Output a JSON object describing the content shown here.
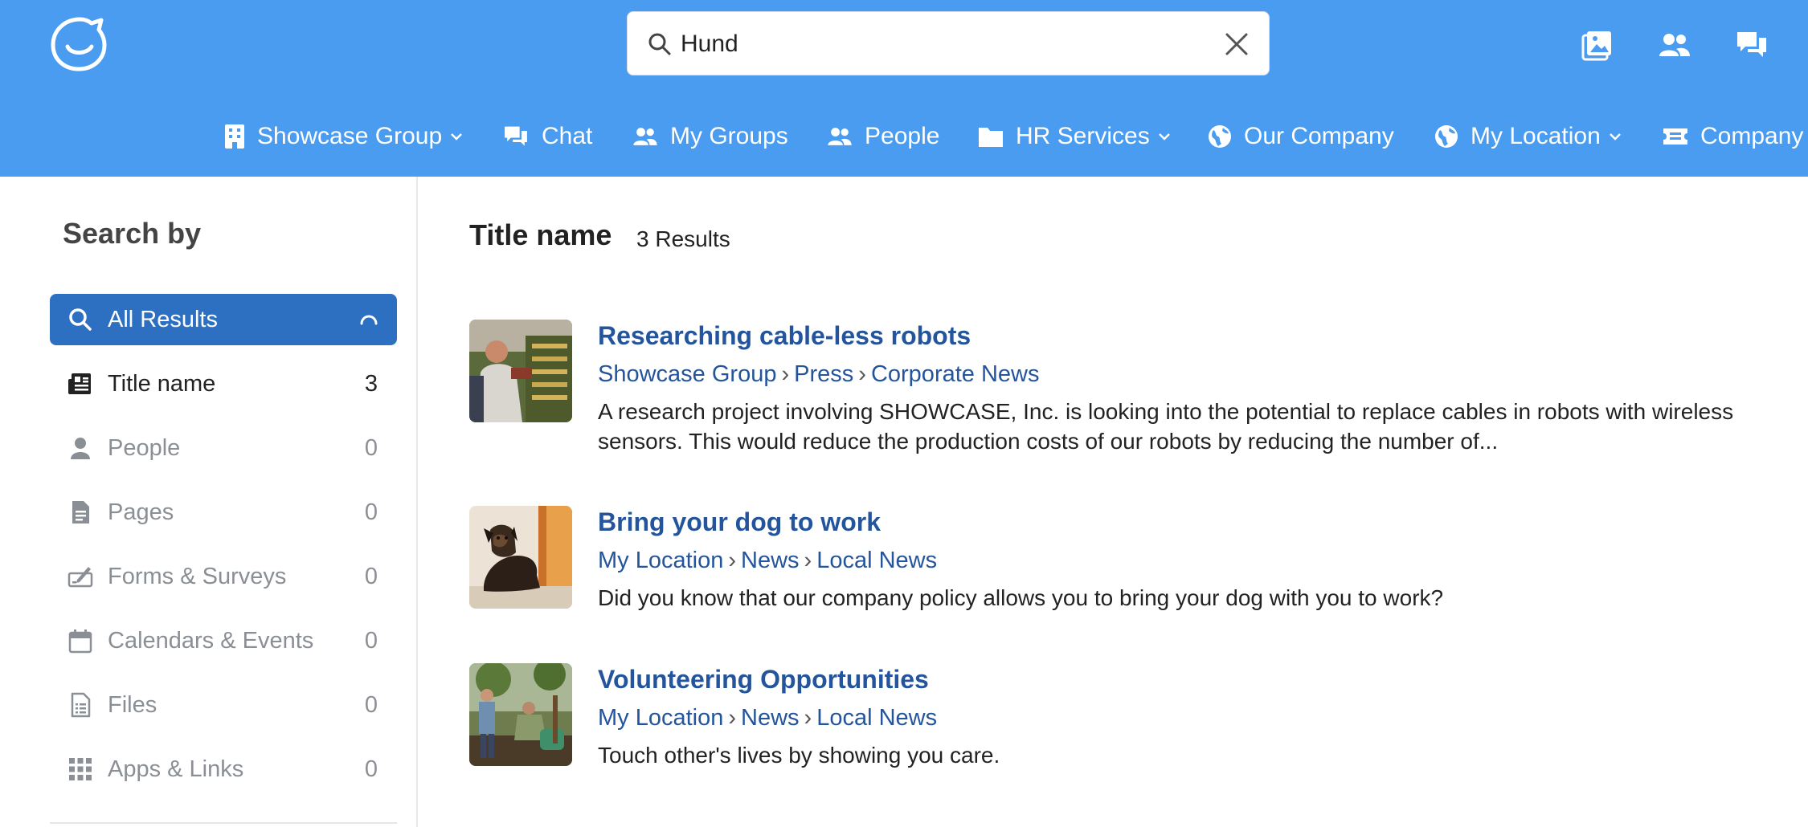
{
  "header": {
    "search": {
      "value": "Hund",
      "placeholder": ""
    },
    "nav": [
      {
        "label": "Showcase Group",
        "icon": "building-icon",
        "dropdown": true
      },
      {
        "label": "Chat",
        "icon": "chat-icon",
        "dropdown": false
      },
      {
        "label": "My Groups",
        "icon": "users-icon",
        "dropdown": false
      },
      {
        "label": "People",
        "icon": "users-icon",
        "dropdown": false
      },
      {
        "label": "HR Services",
        "icon": "folder-icon",
        "dropdown": true
      },
      {
        "label": "Our Company",
        "icon": "globe-icon",
        "dropdown": false
      },
      {
        "label": "My Location",
        "icon": "globe-icon",
        "dropdown": true
      },
      {
        "label": "Company",
        "icon": "ticket-icon",
        "dropdown": false
      }
    ]
  },
  "sidebar": {
    "title": "Search by",
    "filters": [
      {
        "label": "All Results",
        "count": "",
        "icon": "search-icon",
        "state": "active"
      },
      {
        "label": "Title name",
        "count": "3",
        "icon": "newspaper-icon",
        "state": "dark"
      },
      {
        "label": "People",
        "count": "0",
        "icon": "person-icon",
        "state": "muted"
      },
      {
        "label": "Pages",
        "count": "0",
        "icon": "page-icon",
        "state": "muted"
      },
      {
        "label": "Forms & Surveys",
        "count": "0",
        "icon": "form-icon",
        "state": "muted"
      },
      {
        "label": "Calendars & Events",
        "count": "0",
        "icon": "calendar-icon",
        "state": "muted"
      },
      {
        "label": "Files",
        "count": "0",
        "icon": "file-icon",
        "state": "muted"
      },
      {
        "label": "Apps & Links",
        "count": "0",
        "icon": "grid-icon",
        "state": "muted"
      }
    ]
  },
  "main": {
    "title": "Title name",
    "count_label": "3 Results",
    "results": [
      {
        "title": "Researching cable-less robots",
        "path": [
          "Showcase Group",
          "Press",
          "Corporate News"
        ],
        "description": "A research project involving SHOWCASE, Inc. is looking into the potential to replace cables in robots with wireless sensors. This would reduce the production costs of our robots by reducing the number of..."
      },
      {
        "title": "Bring your dog to work",
        "path": [
          "My Location",
          "News",
          "Local News"
        ],
        "description": "Did you know that our company policy allows you to bring your dog with you to work?"
      },
      {
        "title": "Volunteering Opportunities",
        "path": [
          "My Location",
          "News",
          "Local News"
        ],
        "description": "Touch other's lives by showing you care."
      }
    ]
  },
  "colors": {
    "header_bg": "#4a9cf0",
    "active_filter": "#2d6fc1",
    "link": "#24559c"
  }
}
